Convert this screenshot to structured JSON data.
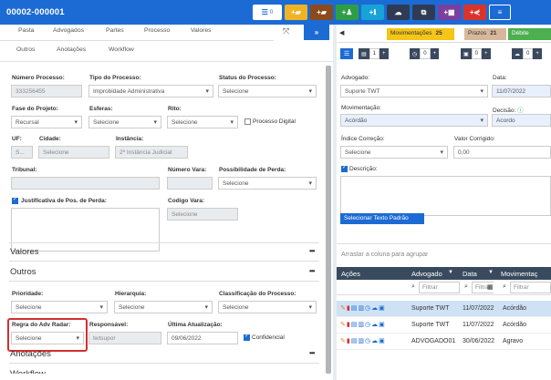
{
  "page_title": "00002-000001",
  "toolbar": {
    "count": "0",
    "buttons": [
      {
        "icon": "list-icon"
      },
      {
        "icon": "plus-folder-icon",
        "glyph": "+▰"
      },
      {
        "icon": "plus-briefcase-icon",
        "glyph": "+▰"
      },
      {
        "icon": "add-user-icon",
        "glyph": "+♟"
      },
      {
        "icon": "add-info-icon",
        "glyph": "+ℹ"
      },
      {
        "icon": "cloud-icon",
        "glyph": "☁"
      },
      {
        "icon": "copy-icon",
        "glyph": "⧉"
      },
      {
        "icon": "add-grid-icon",
        "glyph": "+▦"
      },
      {
        "icon": "share-icon",
        "glyph": "+⋞"
      },
      {
        "icon": "menu-icon",
        "glyph": "≡"
      }
    ]
  },
  "tabs_row1": [
    "Pasta",
    "Advogados",
    "Partes",
    "Processo",
    "Valores"
  ],
  "tabs_row2": [
    "Outros",
    "Anotações",
    "Workflow"
  ],
  "form": {
    "numero_processo": {
      "label": "Número Processo:",
      "value": "333256455"
    },
    "tipo_processo": {
      "label": "Tipo do Processo:",
      "value": "Improbidade Administrativa"
    },
    "status_processo": {
      "label": "Status do Processo:",
      "value": "Selecione"
    },
    "fase_projeto": {
      "label": "Fase do Projeto:",
      "value": "Recursal"
    },
    "esferas": {
      "label": "Esferas:",
      "value": "Selecione"
    },
    "rito": {
      "label": "Rito:",
      "value": "Selecione"
    },
    "processo_digital": "Processo Digital",
    "uf": {
      "label": "UF:",
      "value": "S..."
    },
    "cidade": {
      "label": "Cidade:",
      "value": "Selecione"
    },
    "instancia": {
      "label": "Instância:",
      "value": "2ª Instância Judicial"
    },
    "tribunal": {
      "label": "Tribunal:",
      "value": ""
    },
    "numero_vara": {
      "label": "Número Vara:",
      "value": ""
    },
    "possibilidade_perda": {
      "label": "Possibilidade de Perda:",
      "value": "Selecione"
    },
    "justificativa": "Justificativa de Pos. de Perda:",
    "codigo_vara": {
      "label": "Codigo Vara:",
      "value": "Selecione"
    }
  },
  "sections": {
    "valores": "Valores",
    "outros": "Outros",
    "anotacoes": "Anotações",
    "workflow": "Workflow",
    "more": "•••"
  },
  "outros": {
    "prioridade": {
      "label": "Prioridade:",
      "value": "Selecione"
    },
    "hierarquia": {
      "label": "Hierarquia:",
      "value": "Selecione"
    },
    "classificacao": {
      "label": "Classificação do Processo:",
      "value": "Selecione"
    },
    "regra_adv_radar": {
      "label": "Regra do Adv Radar:",
      "value": "Selecione"
    },
    "responsavel": {
      "label": "Responsável:",
      "value": "twtsupor"
    },
    "ultima_atualizacao": {
      "label": "Última Atualização:",
      "value": "09/06/2022"
    },
    "confidencial": "Confidencial"
  },
  "right": {
    "tabs": [
      {
        "label": "Movimentações",
        "count": "25"
      },
      {
        "label": "Prazos",
        "count": "21"
      },
      {
        "label": "Débite"
      }
    ],
    "toolbar_counts": [
      "1",
      "0",
      "0",
      "0"
    ],
    "advogado": {
      "label": "Advogado:",
      "value": "Suporte TWT"
    },
    "data": {
      "label": "Data:",
      "value": "11/07/2022"
    },
    "movimentacao": {
      "label": "Movimentação:",
      "value": "Acórdão"
    },
    "decisao": {
      "label": "Decisão:",
      "value": "Acordo"
    },
    "indice_correcao": {
      "label": "Índice Correção:",
      "value": "Selecione"
    },
    "valor_corrigido": {
      "label": "Valor Corrigido:",
      "value": "0,00"
    },
    "descricao": "Descrição:",
    "selecionar_texto": "Selecionar Texto Padrão",
    "grid": {
      "drop_hint": "Arrastar a coluna para agrupar",
      "headers": [
        "Ações",
        "Advogado",
        "Data",
        "Movimentaç"
      ],
      "filter_placeholder": "Filtrar",
      "rows": [
        {
          "advogado": "Suporte TWT",
          "data": "11/07/2022",
          "mov": "Acórdão",
          "selected": true
        },
        {
          "advogado": "Suporte TWT",
          "data": "11/07/2022",
          "mov": "Acórdão",
          "selected": false
        },
        {
          "advogado": "ADVOGADO01",
          "data": "30/06/2022",
          "mov": "Agravo",
          "selected": false
        }
      ]
    }
  },
  "colors": {
    "primary": "#1c6bd4",
    "highlight": "#d32f2f"
  }
}
